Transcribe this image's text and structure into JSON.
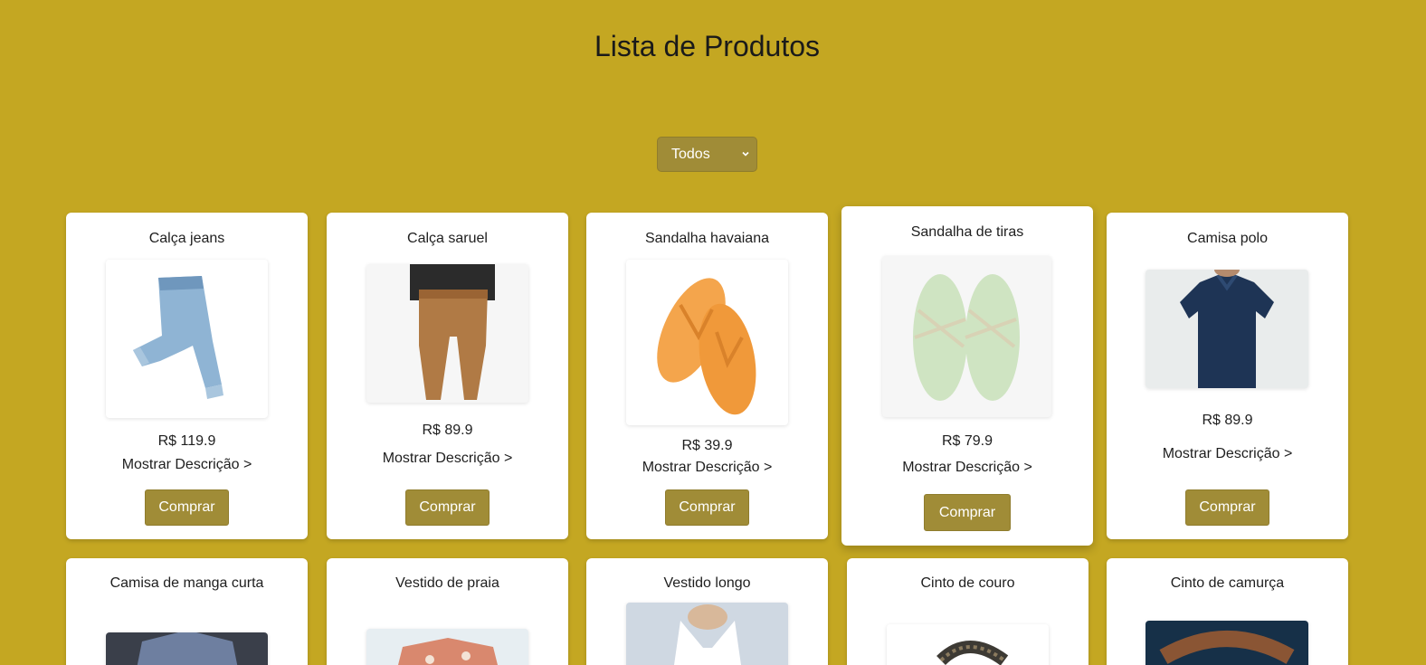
{
  "page": {
    "title": "Lista de Produtos",
    "background": "#c4a722"
  },
  "filter": {
    "selected": "Todos",
    "icon": "chevron-down-icon"
  },
  "products": [
    {
      "name": "Calça jeans",
      "price": "R$ 119.9",
      "desc_label": "Mostrar Descrição >",
      "button": "Comprar"
    },
    {
      "name": "Calça saruel",
      "price": "R$ 89.9",
      "desc_label": "Mostrar Descrição >",
      "button": "Comprar"
    },
    {
      "name": "Sandalha havaiana",
      "price": "R$ 39.9",
      "desc_label": "Mostrar Descrição >",
      "button": "Comprar"
    },
    {
      "name": "Sandalha de tiras",
      "price": "R$ 79.9",
      "desc_label": "Mostrar Descrição >",
      "button": "Comprar"
    },
    {
      "name": "Camisa polo",
      "price": "R$ 89.9",
      "desc_label": "Mostrar Descrição >",
      "button": "Comprar"
    },
    {
      "name": "Camisa de manga curta"
    },
    {
      "name": "Vestido de praia"
    },
    {
      "name": "Vestido longo"
    },
    {
      "name": "Cinto de couro"
    },
    {
      "name": "Cinto de camurça"
    }
  ],
  "colors": {
    "accent_button": "#a08c37",
    "card": "#ffffff"
  }
}
